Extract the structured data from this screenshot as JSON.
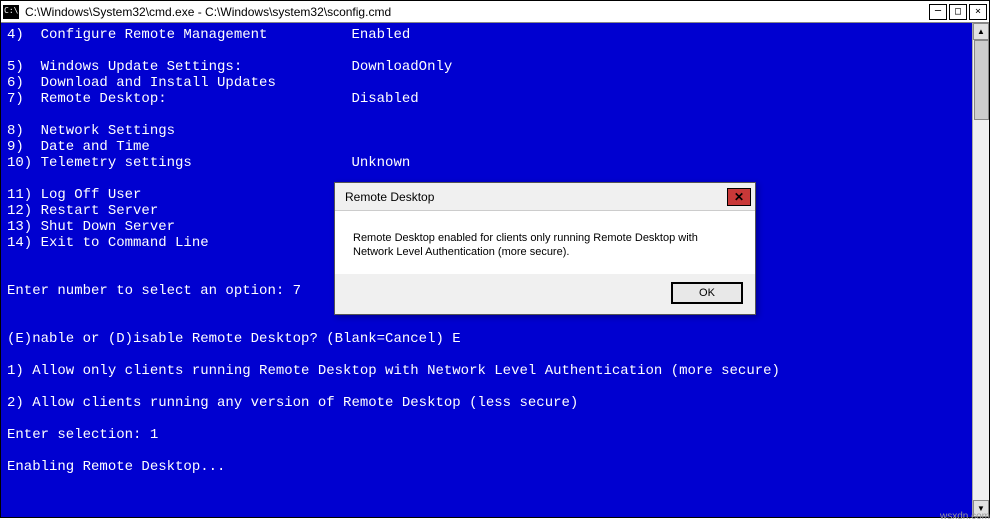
{
  "window": {
    "title": "C:\\Windows\\System32\\cmd.exe - C:\\Windows\\system32\\sconfig.cmd"
  },
  "console": {
    "lines": [
      "4)  Configure Remote Management          Enabled",
      "",
      "5)  Windows Update Settings:             DownloadOnly",
      "6)  Download and Install Updates",
      "7)  Remote Desktop:                      Disabled",
      "",
      "8)  Network Settings",
      "9)  Date and Time",
      "10) Telemetry settings                   Unknown",
      "",
      "11) Log Off User",
      "12) Restart Server",
      "13) Shut Down Server",
      "14) Exit to Command Line",
      "",
      "",
      "Enter number to select an option: 7",
      "",
      "",
      "(E)nable or (D)isable Remote Desktop? (Blank=Cancel) E",
      "",
      "1) Allow only clients running Remote Desktop with Network Level Authentication (more secure)",
      "",
      "2) Allow clients running any version of Remote Desktop (less secure)",
      "",
      "Enter selection: 1",
      "",
      "Enabling Remote Desktop..."
    ]
  },
  "dialog": {
    "title": "Remote Desktop",
    "message": "Remote Desktop enabled for clients only running Remote Desktop with Network Level Authentication (more secure).",
    "ok": "OK"
  },
  "watermark": "wsxdn.com"
}
